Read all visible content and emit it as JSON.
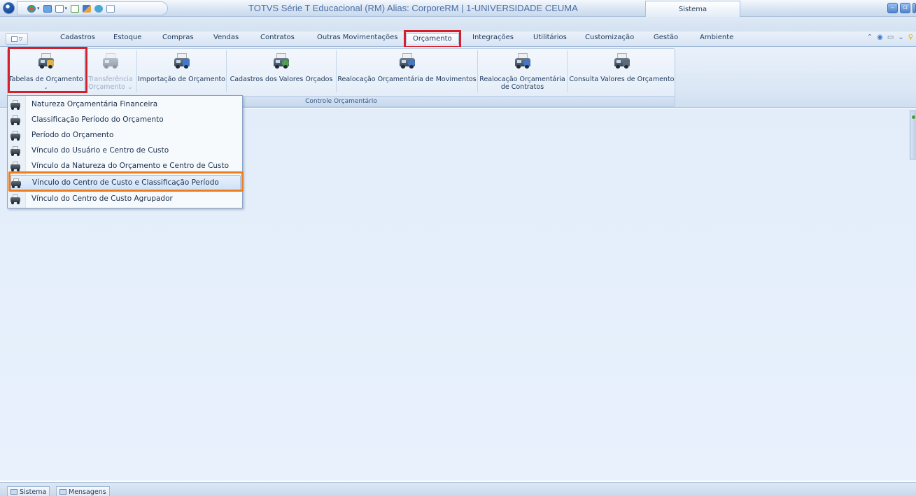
{
  "window": {
    "title": "TOTVS Série T Educacional (RM) Alias: CorporeRM | 1-UNIVERSIDADE CEUMA",
    "context_tab": "Sistema"
  },
  "menu": {
    "tabs": [
      "Cadastros",
      "Estoque",
      "Compras",
      "Vendas",
      "Contratos",
      "Outras Movimentações",
      "Orçamento",
      "Integrações",
      "Utilitários",
      "Customização",
      "Gestão",
      "Ambiente"
    ],
    "active": "Orçamento"
  },
  "ribbon": {
    "group_label": "Controle Orçamentário",
    "buttons": [
      {
        "label": "Tabelas de Orçamento",
        "sub": "⌄",
        "enabled": true
      },
      {
        "label": "Transferência",
        "sub": "Orçamento ⌄",
        "enabled": false
      },
      {
        "label": "Importação de Orçamento",
        "sub": "",
        "enabled": true
      },
      {
        "label": "Cadastros dos Valores Orçados",
        "sub": "",
        "enabled": true
      },
      {
        "label": "Realocação Orçamentária de Movimentos",
        "sub": "",
        "enabled": true
      },
      {
        "label": "Realocação Orçamentária",
        "sub": "de Contratos",
        "enabled": true
      },
      {
        "label": "Consulta Valores de Orçamento",
        "sub": "",
        "enabled": true
      }
    ]
  },
  "dropdown": {
    "items": [
      "Natureza Orçamentária Financeira",
      "Classificação Período do Orçamento",
      "Período do Orçamento",
      "Vínculo do Usuário e Centro de Custo",
      "Vínculo da Natureza do Orçamento e Centro de Custo",
      "Vínculo do Centro de Custo e Classificação Período",
      "Vínculo do Centro de Custo Agrupador"
    ],
    "highlighted_index": 5
  },
  "statusbar": {
    "items": [
      "Sistema",
      "Mensagens"
    ]
  },
  "colors": {
    "highlight_red": "#d5202b",
    "highlight_orange": "#f07d1d",
    "workspace": "#e6effb"
  },
  "icons": [
    "app-orb-icon",
    "quick-access-icons",
    "minimize-icon",
    "restore-icon",
    "close-icon",
    "budget-table-icon"
  ]
}
